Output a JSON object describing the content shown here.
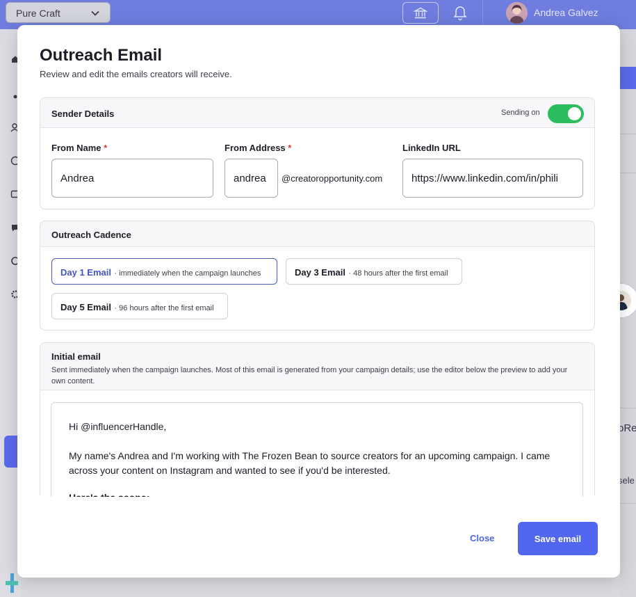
{
  "topbar": {
    "workspace": "Pure Craft",
    "user_name": "Andrea Galvez"
  },
  "background": {
    "right_text_1": "pRe",
    "right_text_2": "sele"
  },
  "modal": {
    "title": "Outreach Email",
    "subtitle": "Review and edit the emails creators will receive.",
    "sender": {
      "title": "Sender Details",
      "sending_label": "Sending on",
      "sending_on": true,
      "from_name_label": "From Name",
      "from_name_value": "Andrea",
      "from_address_label": "From Address",
      "from_address_value": "andrea",
      "domain": "@creatoropportunity.com",
      "linkedin_label": "LinkedIn URL",
      "linkedin_value": "https://www.linkedin.com/in/phili",
      "required_mark": "*"
    },
    "cadence": {
      "title": "Outreach Cadence",
      "items": [
        {
          "name": "Day 1 Email",
          "desc": "· immediately when the campaign launches"
        },
        {
          "name": "Day 3 Email",
          "desc": "· 48 hours after the first email"
        },
        {
          "name": "Day 5 Email",
          "desc": "· 96 hours after the first email"
        }
      ]
    },
    "initial_email": {
      "title": "Initial email",
      "description": "Sent immediately when the campaign launches. Most of this email is generated from your campaign details; use the editor below the preview to add your own content.",
      "greeting": "Hi @influencerHandle,",
      "body": "My name's Andrea and I'm working with The Frozen Bean to source creators for an upcoming campaign. I came across your content on Instagram and wanted to see if you'd be interested.",
      "scope_heading": "Here's the scope:"
    },
    "close_label": "Close",
    "save_label": "Save email"
  },
  "colors": {
    "topbar": "#6e7dde",
    "accent": "#5167f0",
    "toggle_on": "#2dbd5f",
    "required": "#d93a3a"
  }
}
